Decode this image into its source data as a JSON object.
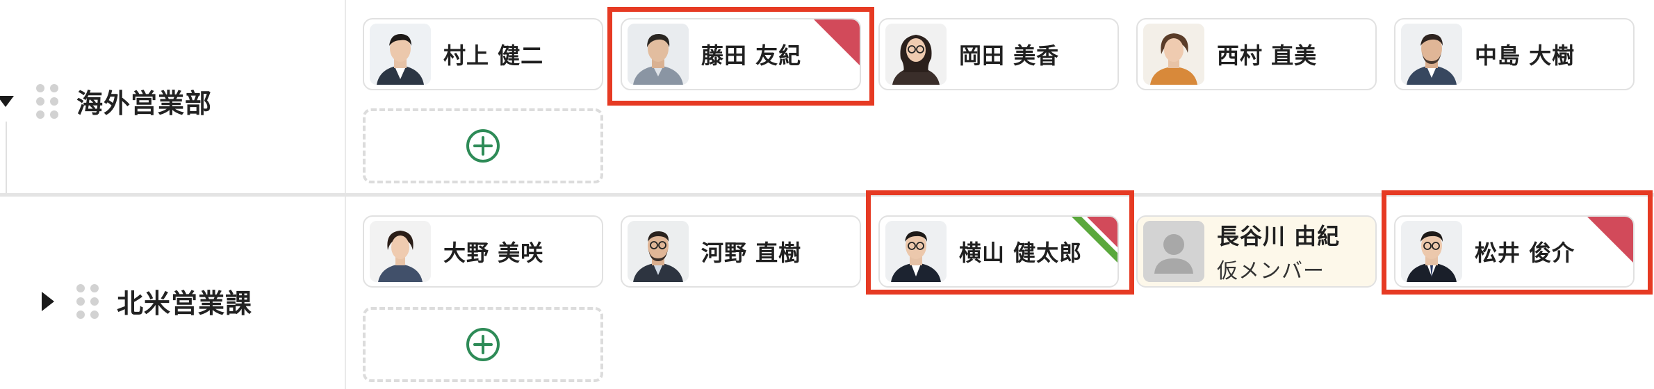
{
  "groups": [
    {
      "name": "海外営業部",
      "members": [
        {
          "name": "村上 健二",
          "sub": "",
          "avatar": "man-suit"
        },
        {
          "name": "藤田 友紀",
          "sub": "",
          "avatar": "man-casual"
        },
        {
          "name": "岡田 美香",
          "sub": "",
          "avatar": "woman-glasses"
        },
        {
          "name": "西村 直美",
          "sub": "",
          "avatar": "woman-orange"
        },
        {
          "name": "中島 大樹",
          "sub": "",
          "avatar": "man-beard"
        }
      ]
    },
    {
      "name": "北米営業課",
      "members": [
        {
          "name": "大野 美咲",
          "sub": "",
          "avatar": "woman-dark"
        },
        {
          "name": "河野 直樹",
          "sub": "",
          "avatar": "man-beard-glasses"
        },
        {
          "name": "横山 健太郎",
          "sub": "",
          "avatar": "man-glasses"
        },
        {
          "name": "長谷川 由紀",
          "sub": "仮メンバー",
          "avatar": "placeholder"
        },
        {
          "name": "松井 俊介",
          "sub": "",
          "avatar": "man-glasses-2"
        }
      ]
    }
  ],
  "icons": {
    "add": "plus-circle-icon",
    "drag": "drag-handle-icon",
    "expanded": "caret-down-icon",
    "collapsed": "caret-right-icon"
  },
  "colors": {
    "highlight": "#e63a23",
    "corner_red": "#d24a5a",
    "corner_green": "#5aa83c",
    "add_green": "#2e8b57",
    "provisional_bg": "#fdf8ea"
  }
}
